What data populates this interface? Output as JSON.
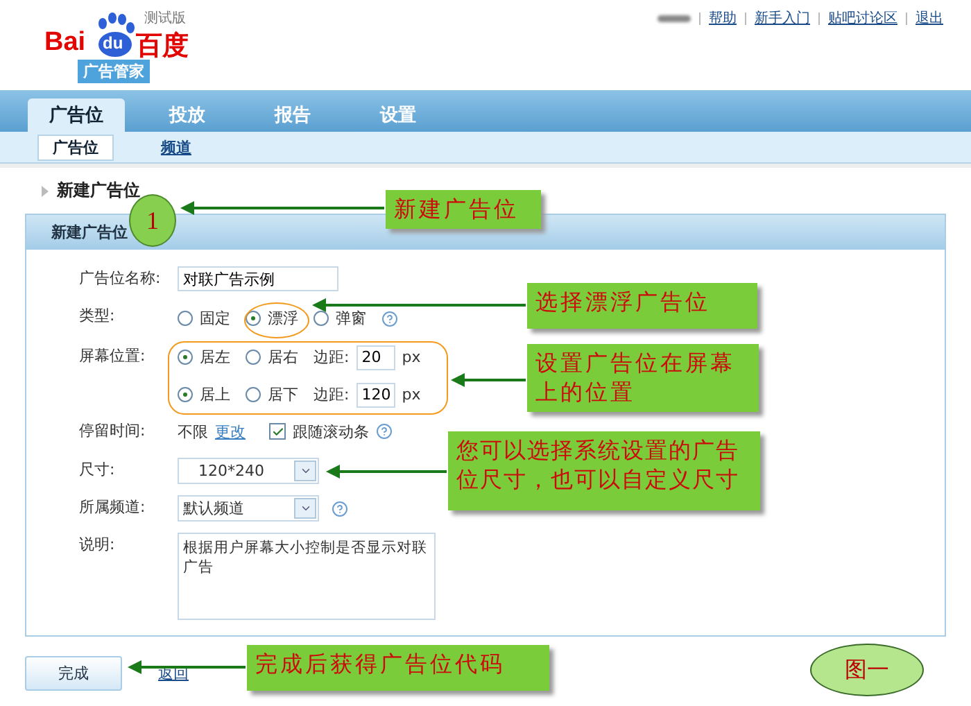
{
  "header": {
    "logo": {
      "left": "Bai",
      "paw": "du",
      "right": "百度",
      "edition": "测试版",
      "product": "广告管家"
    },
    "links": [
      "帮助",
      "新手入门",
      "贴吧讨论区",
      "退出"
    ]
  },
  "nav_tabs": [
    {
      "label": "广告位",
      "selected": true
    },
    {
      "label": "投放",
      "selected": false
    },
    {
      "label": "报告",
      "selected": false
    },
    {
      "label": "设置",
      "selected": false
    }
  ],
  "sub_tabs": [
    {
      "label": "广告位",
      "selected": true
    },
    {
      "label": "频道",
      "selected": false
    }
  ],
  "breadcrumb": "新建广告位",
  "panel": {
    "title": "新建广告位",
    "fields": [
      {
        "kind": "text",
        "label": "广告位名称:",
        "value": "对联广告示例"
      },
      {
        "kind": "radio",
        "label": "类型:",
        "options": [
          {
            "label": "固定",
            "selected": false
          },
          {
            "label": "漂浮",
            "selected": true
          },
          {
            "label": "弹窗",
            "selected": false
          }
        ]
      },
      {
        "kind": "position",
        "label": "屏幕位置:",
        "rows": [
          {
            "options": [
              {
                "label": "居左",
                "selected": true
              },
              {
                "label": "居右",
                "selected": false
              }
            ],
            "margin_label": "边距:",
            "value": "20",
            "unit": "px"
          },
          {
            "options": [
              {
                "label": "居上",
                "selected": true
              },
              {
                "label": "居下",
                "selected": false
              }
            ],
            "margin_label": "边距:",
            "value": "120",
            "unit": "px"
          }
        ]
      },
      {
        "kind": "stay",
        "label": "停留时间:",
        "value": "不限",
        "link": "更改",
        "checkbox": {
          "label": "跟随滚动条",
          "checked": true
        }
      },
      {
        "kind": "select",
        "label": "尺寸:",
        "value": "120*240"
      },
      {
        "kind": "select",
        "label": "所属频道:",
        "value": "默认频道",
        "help": true
      },
      {
        "kind": "textarea",
        "label": "说明:",
        "value": "根据用户屏幕大小控制是否显示对联广告"
      }
    ]
  },
  "buttons": {
    "submit": "完成",
    "back": "返回"
  },
  "annotations": [
    {
      "kind": "circle",
      "text": "1"
    },
    {
      "kind": "callout",
      "text": "新建广告位"
    },
    {
      "kind": "callout",
      "text": "选择漂浮广告位"
    },
    {
      "kind": "callout",
      "text": "设置广告位在屏幕上的位置"
    },
    {
      "kind": "callout",
      "text": "您可以选择系统设置的广告位尺寸，也可以自定义尺寸"
    },
    {
      "kind": "callout",
      "text": "完成后获得广告位代码"
    },
    {
      "kind": "figure_label",
      "text": "图一"
    }
  ]
}
